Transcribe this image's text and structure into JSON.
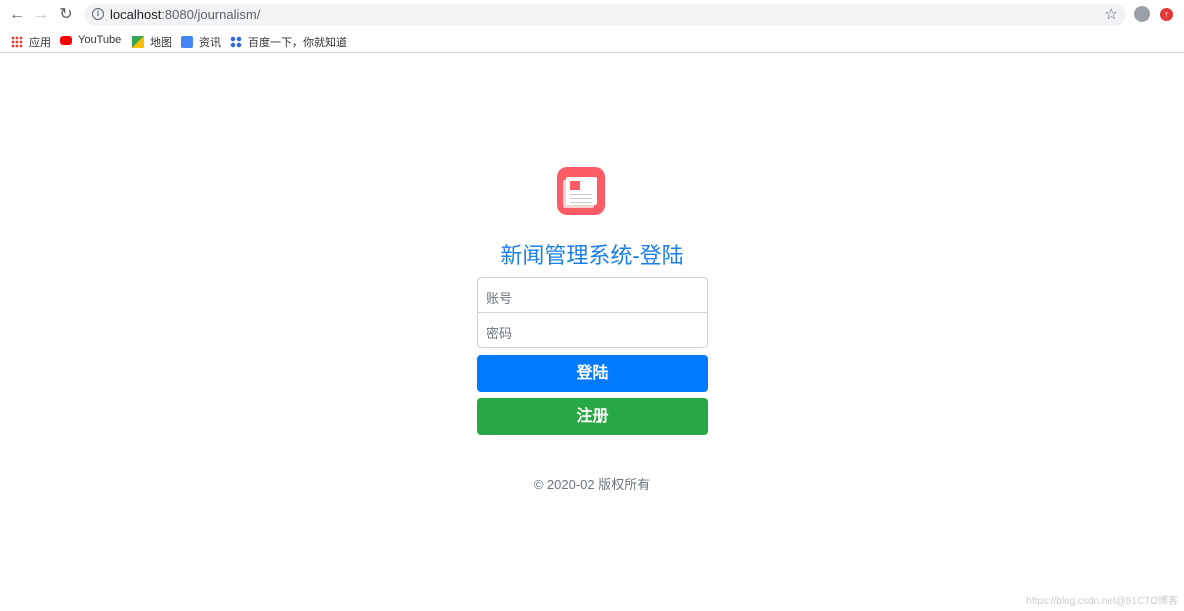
{
  "browser": {
    "url_host": "localhost",
    "url_rest": ":8080/journalism/",
    "bookmarks": [
      {
        "label": "应用",
        "icon": "apps-grid-icon"
      },
      {
        "label": "YouTube",
        "icon": "youtube-icon"
      },
      {
        "label": "地图",
        "icon": "maps-icon"
      },
      {
        "label": "资讯",
        "icon": "news-icon"
      },
      {
        "label": "百度一下，你就知道",
        "icon": "baidu-paw-icon"
      }
    ]
  },
  "login": {
    "title": "新闻管理系统-登陆",
    "account_placeholder": "账号",
    "password_placeholder": "密码",
    "login_label": "登陆",
    "register_label": "注册",
    "footer": "© 2020-02 版权所有"
  },
  "watermark": "https://blog.csdn.net@51CTO博客",
  "colors": {
    "primary": "#007bff",
    "success": "#28a745",
    "logo": "#fd5b66",
    "title": "#1a7fea"
  }
}
